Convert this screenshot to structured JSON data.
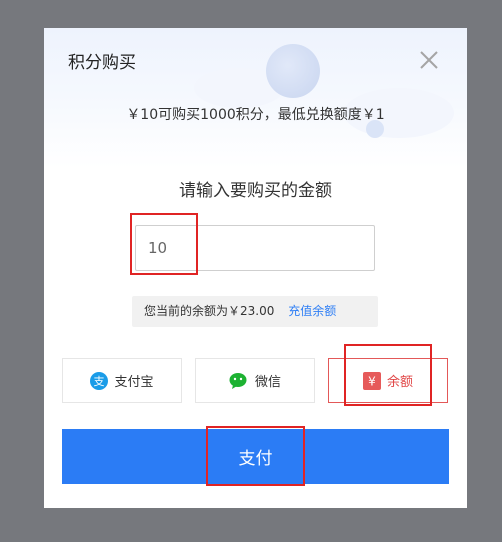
{
  "dialog": {
    "title": "积分购买",
    "subtitle": "￥10可购买1000积分，最低兑换额度￥1",
    "prompt": "请输入要购买的金额",
    "amount_value": "10",
    "balance_label": "您当前的余额为￥23.00",
    "recharge_link": "充值余额",
    "payment_methods": [
      {
        "label": "支付宝",
        "icon": "alipay-icon",
        "color": "#1a9ce8"
      },
      {
        "label": "微信",
        "icon": "wechat-icon",
        "color": "#1db232"
      },
      {
        "label": "余额",
        "icon": "balance-yen-icon",
        "color": "#e65a5a",
        "selected": true
      }
    ],
    "pay_button": "支付"
  },
  "colors": {
    "primary": "#2b7cf5",
    "highlight": "#e02424",
    "overlay": "#76787d"
  }
}
